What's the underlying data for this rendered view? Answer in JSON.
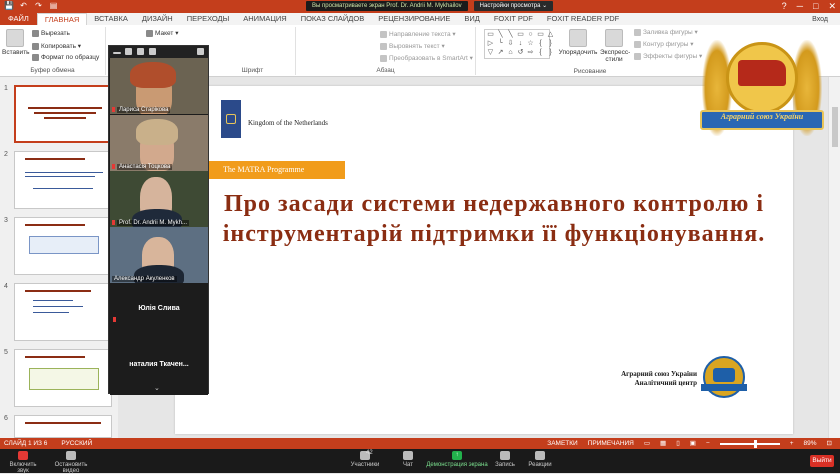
{
  "titlebar": {
    "zoom_msg": "Вы просматриваете экран Prof. Dr. Andrii M. Mykhailov",
    "zoom_options": "Настройки просмотра ⌄",
    "quick_icons": [
      "💾",
      "↶",
      "↷",
      "▤"
    ],
    "window_controls": [
      "?",
      "─",
      "□",
      "✕"
    ]
  },
  "tabs": {
    "items": [
      "ФАЙЛ",
      "ГЛАВНАЯ",
      "ВСТАВКА",
      "ДИЗАЙН",
      "ПЕРЕХОДЫ",
      "АНИМАЦИЯ",
      "ПОКАЗ СЛАЙДОВ",
      "РЕЦЕНЗИРОВАНИЕ",
      "ВИД",
      "FOXIT PDF",
      "FOXIT READER PDF"
    ],
    "active_index": 1,
    "login": "Вход"
  },
  "ribbon": {
    "paste": "Вставить",
    "cut": "Вырезать",
    "copy": "Копировать ▾",
    "format_painter": "Формат по образцу",
    "clipboard_label": "Буфер обмена",
    "layout": "Макет ▾",
    "font_label": "Шрифт",
    "paragraph_label": "Абзац",
    "text_direction": "Направление текста ▾",
    "align_text": "Выровнять текст ▾",
    "smartart": "Преобразовать в SmartArt ▾",
    "arrange": "Упорядочить",
    "quick_styles": "Экспресс-стили",
    "shape_fill": "Заливка фигуры ▾",
    "shape_outline": "Контур фигуры ▾",
    "shape_effects": "Эффекты фигуры ▾",
    "drawing_label": "Рисование",
    "shape_glyphs": [
      "▭",
      "╲",
      "╲",
      "▭",
      "○",
      "▭",
      "△",
      "▷",
      "╰",
      "⇩",
      "↓",
      "☆",
      "{",
      "}",
      "▽",
      "↗",
      "⌂",
      "↺",
      "⇨",
      "{",
      "}"
    ]
  },
  "thumbnails": [
    {
      "num": "1",
      "selected": true
    },
    {
      "num": "2",
      "selected": false
    },
    {
      "num": "3",
      "selected": false
    },
    {
      "num": "4",
      "selected": false
    },
    {
      "num": "5",
      "selected": false
    },
    {
      "num": "6",
      "selected": false
    }
  ],
  "slide": {
    "nl_text": "Kingdom of the Netherlands",
    "matra": "The MATRA Programme",
    "title": "Про засади системи недержавного контролю і інструментарій підтримки її функціонування.",
    "org_line1": "Аграрний союз України",
    "org_line2": "Аналітичний центр",
    "emblem_text": "Аграрний союз України"
  },
  "gallery": {
    "participants": [
      {
        "name": "Лариса Старікова",
        "muted": true
      },
      {
        "name": "Анастасія Тоцкова",
        "muted": true
      },
      {
        "name": "Prof. Dr. Andrii M. Mykh...",
        "muted": true
      },
      {
        "name": "Александр Акуленков",
        "muted": false
      }
    ],
    "no_video": [
      {
        "name": "Юлія Слива",
        "muted": false
      },
      {
        "name": "наталия  Ткачен...",
        "muted": true
      }
    ]
  },
  "status": {
    "slide": "СЛАЙД 1 ИЗ 6",
    "language": "РУССКИЙ",
    "notes": "ЗАМЕТКИ",
    "comments": "ПРИМЕЧАНИЯ",
    "zoom": "89%"
  },
  "zoom_toolbar": {
    "mute": "Включить звук",
    "video": "Остановить видео",
    "participants": "Участники",
    "participants_count": "42",
    "chat": "Чат",
    "share": "Демонстрация экрана",
    "record": "Запись",
    "reactions": "Реакции",
    "leave": "Выйти"
  },
  "colors": {
    "accent": "#c43e1c",
    "title": "#8a2d12",
    "matra": "#f19c1b",
    "nl_blue": "#2b4a8a"
  }
}
